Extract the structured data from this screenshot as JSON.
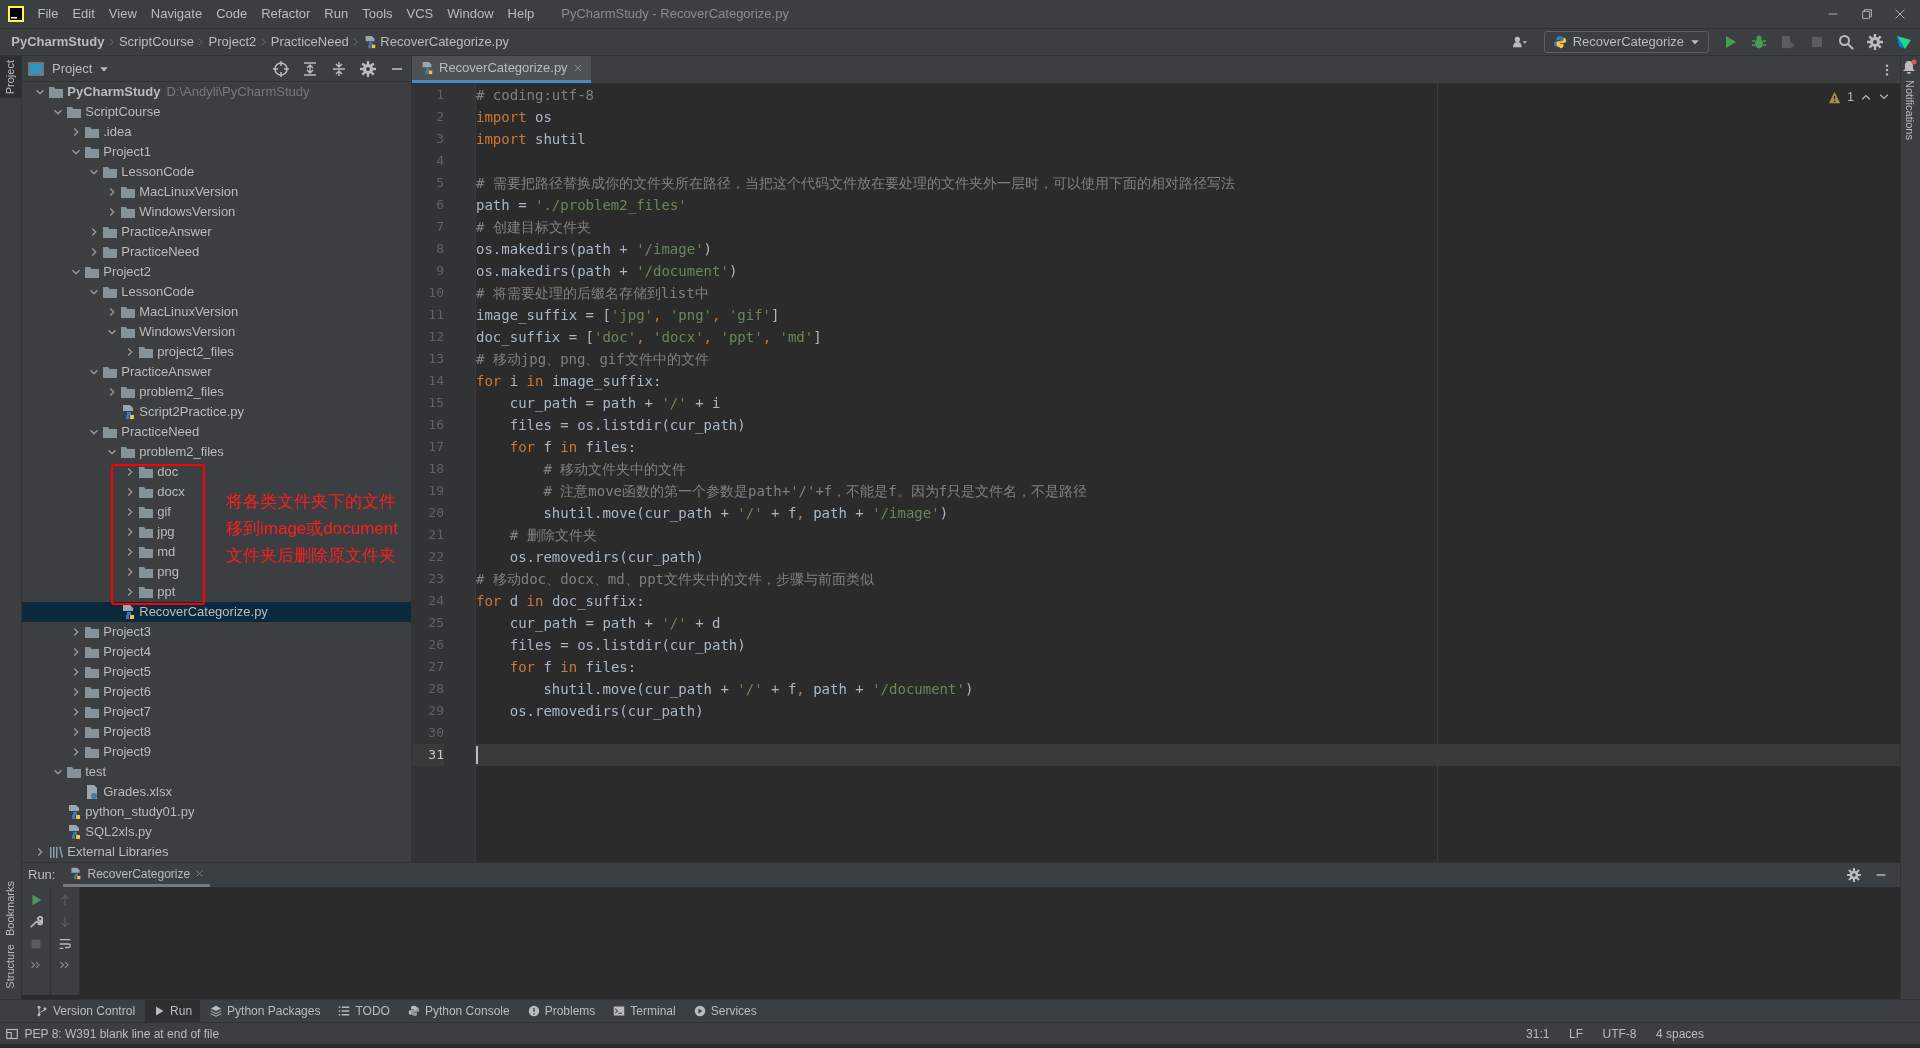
{
  "menu": [
    "File",
    "Edit",
    "View",
    "Navigate",
    "Code",
    "Refactor",
    "Run",
    "Tools",
    "VCS",
    "Window",
    "Help"
  ],
  "window_title": "PyCharmStudy - RecoverCategorize.py",
  "breadcrumbs": [
    {
      "label": "PyCharmStudy",
      "kind": "project"
    },
    {
      "label": "ScriptCourse",
      "kind": "folder"
    },
    {
      "label": "Project2",
      "kind": "folder"
    },
    {
      "label": "PracticeNeed",
      "kind": "folder"
    },
    {
      "label": "RecoverCategorize.py",
      "kind": "python"
    }
  ],
  "run_config": "RecoverCategorize",
  "side_tabs": {
    "left": [
      {
        "label": "Project",
        "selected": true
      },
      {
        "label": "Bookmarks",
        "selected": false
      },
      {
        "label": "Structure",
        "selected": false
      }
    ],
    "right": [
      "Notifications"
    ]
  },
  "project_panel": {
    "title": "Project",
    "tree": [
      {
        "label": "PyCharmStudy",
        "path": "D:\\Andyli\\PyCharmStudy",
        "kind": "folder",
        "expanded": true,
        "selected": false,
        "children": [
          {
            "label": "ScriptCourse",
            "kind": "folder",
            "expanded": true,
            "selected": false,
            "children": [
              {
                "label": ".idea",
                "kind": "folder",
                "expanded": false,
                "selected": false
              },
              {
                "label": "Project1",
                "kind": "folder",
                "expanded": true,
                "selected": false,
                "children": [
                  {
                    "label": "LessonCode",
                    "kind": "folder",
                    "expanded": true,
                    "selected": false,
                    "children": [
                      {
                        "label": "MacLinuxVersion",
                        "kind": "folder",
                        "expanded": false,
                        "selected": false
                      },
                      {
                        "label": "WindowsVersion",
                        "kind": "folder",
                        "expanded": false,
                        "selected": false
                      }
                    ]
                  },
                  {
                    "label": "PracticeAnswer",
                    "kind": "folder",
                    "expanded": false,
                    "selected": false
                  },
                  {
                    "label": "PracticeNeed",
                    "kind": "folder",
                    "expanded": false,
                    "selected": false
                  }
                ]
              },
              {
                "label": "Project2",
                "kind": "folder",
                "expanded": true,
                "selected": false,
                "children": [
                  {
                    "label": "LessonCode",
                    "kind": "folder",
                    "expanded": true,
                    "selected": false,
                    "children": [
                      {
                        "label": "MacLinuxVersion",
                        "kind": "folder",
                        "expanded": false,
                        "selected": false
                      },
                      {
                        "label": "WindowsVersion",
                        "kind": "folder",
                        "expanded": true,
                        "selected": false,
                        "children": [
                          {
                            "label": "project2_files",
                            "kind": "folder",
                            "expanded": false,
                            "selected": false
                          }
                        ]
                      }
                    ]
                  },
                  {
                    "label": "PracticeAnswer",
                    "kind": "folder",
                    "expanded": true,
                    "selected": false,
                    "children": [
                      {
                        "label": "problem2_files",
                        "kind": "folder",
                        "expanded": false,
                        "selected": false
                      },
                      {
                        "label": "Script2Practice.py",
                        "kind": "python",
                        "selected": false
                      }
                    ]
                  },
                  {
                    "label": "PracticeNeed",
                    "kind": "folder",
                    "expanded": true,
                    "selected": false,
                    "children": [
                      {
                        "label": "problem2_files",
                        "kind": "folder",
                        "expanded": true,
                        "selected": false,
                        "children": [
                          {
                            "label": "doc",
                            "kind": "folder",
                            "expanded": false,
                            "selected": false
                          },
                          {
                            "label": "docx",
                            "kind": "folder",
                            "expanded": false,
                            "selected": false
                          },
                          {
                            "label": "gif",
                            "kind": "folder",
                            "expanded": false,
                            "selected": false
                          },
                          {
                            "label": "jpg",
                            "kind": "folder",
                            "expanded": false,
                            "selected": false
                          },
                          {
                            "label": "md",
                            "kind": "folder",
                            "expanded": false,
                            "selected": false
                          },
                          {
                            "label": "png",
                            "kind": "folder",
                            "expanded": false,
                            "selected": false
                          },
                          {
                            "label": "ppt",
                            "kind": "folder",
                            "expanded": false,
                            "selected": false
                          }
                        ]
                      },
                      {
                        "label": "RecoverCategorize.py",
                        "kind": "python",
                        "selected": true
                      }
                    ]
                  }
                ]
              },
              {
                "label": "Project3",
                "kind": "folder",
                "expanded": false,
                "selected": false
              },
              {
                "label": "Project4",
                "kind": "folder",
                "expanded": false,
                "selected": false
              },
              {
                "label": "Project5",
                "kind": "folder",
                "expanded": false,
                "selected": false
              },
              {
                "label": "Project6",
                "kind": "folder",
                "expanded": false,
                "selected": false
              },
              {
                "label": "Project7",
                "kind": "folder",
                "expanded": false,
                "selected": false
              },
              {
                "label": "Project8",
                "kind": "folder",
                "expanded": false,
                "selected": false
              },
              {
                "label": "Project9",
                "kind": "folder",
                "expanded": false,
                "selected": false
              }
            ]
          },
          {
            "label": "test",
            "kind": "folder",
            "expanded": true,
            "selected": false,
            "children": [
              {
                "label": "Grades.xlsx",
                "kind": "unknown",
                "selected": false
              }
            ]
          },
          {
            "label": "python_study01.py",
            "kind": "python",
            "selected": false
          },
          {
            "label": "SQL2xls.py",
            "kind": "python",
            "selected": false
          }
        ]
      },
      {
        "label": "External Libraries",
        "kind": "library",
        "expanded": false,
        "selected": false
      }
    ]
  },
  "annotation": {
    "lines": [
      "将各类文件夹下的文件",
      "移到image或document",
      "文件夹后删除原文件夹"
    ]
  },
  "editor": {
    "tabs": [
      {
        "label": "RecoverCategorize.py",
        "selected": true
      }
    ],
    "warning_count": "1",
    "lines": [
      {
        "number": "1",
        "current": false,
        "tokens": [
          {
            "kind": "comment",
            "text": "# coding:utf-8"
          }
        ]
      },
      {
        "number": "2",
        "current": false,
        "tokens": [
          {
            "kind": "keyword",
            "text": "import"
          },
          {
            "kind": "plain",
            "text": " os"
          }
        ]
      },
      {
        "number": "3",
        "current": false,
        "tokens": [
          {
            "kind": "keyword",
            "text": "import"
          },
          {
            "kind": "plain",
            "text": " shutil"
          }
        ]
      },
      {
        "number": "4",
        "current": false
      },
      {
        "number": "5",
        "current": false,
        "tokens": [
          {
            "kind": "comment",
            "text": "# 需要把路径替换成你的文件夹所在路径，当把这个代码文件放在要处理的文件夹外一层时，可以使用下面的相对路径写法"
          }
        ]
      },
      {
        "number": "6",
        "current": false,
        "tokens": [
          {
            "kind": "plain",
            "text": "path = "
          },
          {
            "kind": "string",
            "text": "'./problem2_files'"
          }
        ]
      },
      {
        "number": "7",
        "current": false,
        "tokens": [
          {
            "kind": "comment",
            "text": "# 创建目标文件夹"
          }
        ]
      },
      {
        "number": "8",
        "current": false,
        "tokens": [
          {
            "kind": "plain",
            "text": "os.makedirs(path + "
          },
          {
            "kind": "string",
            "text": "'/image'"
          },
          {
            "kind": "plain",
            "text": ")"
          }
        ]
      },
      {
        "number": "9",
        "current": false,
        "tokens": [
          {
            "kind": "plain",
            "text": "os.makedirs(path + "
          },
          {
            "kind": "string",
            "text": "'/document'"
          },
          {
            "kind": "plain",
            "text": ")"
          }
        ]
      },
      {
        "number": "10",
        "current": false,
        "tokens": [
          {
            "kind": "comment",
            "text": "# 将需要处理的后缀名存储到list中"
          }
        ]
      },
      {
        "number": "11",
        "current": false,
        "tokens": [
          {
            "kind": "plain",
            "text": "image_suffix = ["
          },
          {
            "kind": "string",
            "text": "'jpg'"
          },
          {
            "kind": "keyword",
            "text": ", "
          },
          {
            "kind": "string",
            "text": "'png'"
          },
          {
            "kind": "keyword",
            "text": ", "
          },
          {
            "kind": "string",
            "text": "'gif'"
          },
          {
            "kind": "plain",
            "text": "]"
          }
        ]
      },
      {
        "number": "12",
        "current": false,
        "tokens": [
          {
            "kind": "plain",
            "text": "doc_suffix = ["
          },
          {
            "kind": "string",
            "text": "'doc'"
          },
          {
            "kind": "keyword",
            "text": ", "
          },
          {
            "kind": "string",
            "text": "'docx'"
          },
          {
            "kind": "keyword",
            "text": ", "
          },
          {
            "kind": "string",
            "text": "'ppt'"
          },
          {
            "kind": "keyword",
            "text": ", "
          },
          {
            "kind": "string",
            "text": "'md'"
          },
          {
            "kind": "plain",
            "text": "]"
          }
        ]
      },
      {
        "number": "13",
        "current": false,
        "tokens": [
          {
            "kind": "comment",
            "text": "# 移动jpg、png、gif文件中的文件"
          }
        ]
      },
      {
        "number": "14",
        "current": false,
        "tokens": [
          {
            "kind": "keyword",
            "text": "for"
          },
          {
            "kind": "plain",
            "text": " i "
          },
          {
            "kind": "keyword",
            "text": "in"
          },
          {
            "kind": "plain",
            "text": " image_suffix:"
          }
        ]
      },
      {
        "number": "15",
        "current": false,
        "tokens": [
          {
            "kind": "plain",
            "text": "    cur_path = path + "
          },
          {
            "kind": "string",
            "text": "'/'"
          },
          {
            "kind": "plain",
            "text": " + i"
          }
        ]
      },
      {
        "number": "16",
        "current": false,
        "tokens": [
          {
            "kind": "plain",
            "text": "    files = os.listdir(cur_path)"
          }
        ]
      },
      {
        "number": "17",
        "current": false,
        "tokens": [
          {
            "kind": "keyword",
            "text": "    for"
          },
          {
            "kind": "plain",
            "text": " f "
          },
          {
            "kind": "keyword",
            "text": "in"
          },
          {
            "kind": "plain",
            "text": " files:"
          }
        ]
      },
      {
        "number": "18",
        "current": false,
        "tokens": [
          {
            "kind": "comment",
            "text": "        # 移动文件夹中的文件"
          }
        ]
      },
      {
        "number": "19",
        "current": false,
        "tokens": [
          {
            "kind": "comment",
            "text": "        # 注意move函数的第一个参数是path+'/'+f，不能是f。因为f只是文件名，不是路径"
          }
        ]
      },
      {
        "number": "20",
        "current": false,
        "tokens": [
          {
            "kind": "plain",
            "text": "        shutil.move(cur_path + "
          },
          {
            "kind": "string",
            "text": "'/'"
          },
          {
            "kind": "plain",
            "text": " + f"
          },
          {
            "kind": "keyword",
            "text": ","
          },
          {
            "kind": "plain",
            "text": " path + "
          },
          {
            "kind": "string",
            "text": "'/image'"
          },
          {
            "kind": "plain",
            "text": ")"
          }
        ]
      },
      {
        "number": "21",
        "current": false,
        "tokens": [
          {
            "kind": "comment",
            "text": "    # 删除文件夹"
          }
        ]
      },
      {
        "number": "22",
        "current": false,
        "tokens": [
          {
            "kind": "plain",
            "text": "    os.removedirs(cur_path)"
          }
        ]
      },
      {
        "number": "23",
        "current": false,
        "tokens": [
          {
            "kind": "comment",
            "text": "# 移动doc、docx、md、ppt文件夹中的文件，步骤与前面类似"
          }
        ]
      },
      {
        "number": "24",
        "current": false,
        "tokens": [
          {
            "kind": "keyword",
            "text": "for"
          },
          {
            "kind": "plain",
            "text": " d "
          },
          {
            "kind": "keyword",
            "text": "in"
          },
          {
            "kind": "plain",
            "text": " doc_suffix:"
          }
        ]
      },
      {
        "number": "25",
        "current": false,
        "tokens": [
          {
            "kind": "plain",
            "text": "    cur_path = path + "
          },
          {
            "kind": "string",
            "text": "'/'"
          },
          {
            "kind": "plain",
            "text": " + d"
          }
        ]
      },
      {
        "number": "26",
        "current": false,
        "tokens": [
          {
            "kind": "plain",
            "text": "    files = os.listdir(cur_path)"
          }
        ]
      },
      {
        "number": "27",
        "current": false,
        "tokens": [
          {
            "kind": "keyword",
            "text": "    for"
          },
          {
            "kind": "plain",
            "text": " f "
          },
          {
            "kind": "keyword",
            "text": "in"
          },
          {
            "kind": "plain",
            "text": " files:"
          }
        ]
      },
      {
        "number": "28",
        "current": false,
        "tokens": [
          {
            "kind": "plain",
            "text": "        shutil.move(cur_path + "
          },
          {
            "kind": "string",
            "text": "'/'"
          },
          {
            "kind": "plain",
            "text": " + f"
          },
          {
            "kind": "keyword",
            "text": ","
          },
          {
            "kind": "plain",
            "text": " path + "
          },
          {
            "kind": "string",
            "text": "'/document'"
          },
          {
            "kind": "plain",
            "text": ")"
          }
        ]
      },
      {
        "number": "29",
        "current": false,
        "tokens": [
          {
            "kind": "plain",
            "text": "    os.removedirs(cur_path)"
          }
        ]
      },
      {
        "number": "30",
        "current": false
      },
      {
        "number": "31",
        "current": true
      }
    ]
  },
  "run_panel": {
    "label": "Run:",
    "tabs": [
      {
        "label": "RecoverCategorize",
        "selected": true
      }
    ]
  },
  "tool_windows": [
    {
      "label": "Version Control",
      "selected": false
    },
    {
      "label": "Run",
      "selected": true
    },
    {
      "label": "Python Packages",
      "selected": false
    },
    {
      "label": "TODO",
      "selected": false
    },
    {
      "label": "Python Console",
      "selected": false
    },
    {
      "label": "Problems",
      "selected": false
    },
    {
      "label": "Terminal",
      "selected": false
    },
    {
      "label": "Services",
      "selected": false
    }
  ],
  "status": {
    "message": "PEP 8: W391 blank line at end of file",
    "items": [
      "31:1",
      "LF",
      "UTF-8",
      "4 spaces"
    ]
  }
}
